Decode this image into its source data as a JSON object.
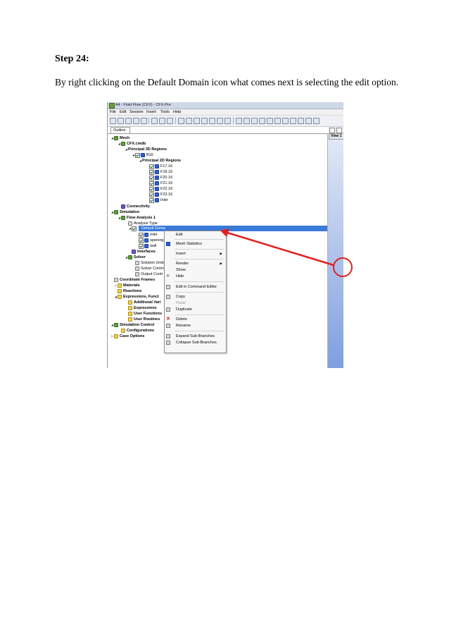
{
  "document": {
    "heading": "Step 24:",
    "instruction": "By right clicking on the Default Domain icon what comes next is selecting the edit option."
  },
  "screenshot": {
    "window_title": "A4 : Fluid Flow (CFX) - CFX-Pre",
    "menu": [
      "File",
      "Edit",
      "Session",
      "Insert",
      "Tools",
      "Help"
    ],
    "outline_tab": "Outline",
    "view_tab": "View 1",
    "tree": {
      "mesh": "Mesh",
      "mesh_file": "CFX.cmdb",
      "principal_3d": "Principal 3D Regions",
      "b16": "B16",
      "principal_2d": "Principal 2D Regions",
      "f17": "F17.16",
      "f18": "F18.16",
      "f20": "F20.16",
      "f21": "F21.16",
      "f22": "F22.16",
      "f23": "F23.16",
      "inlet": "Inlet",
      "connectivity": "Connectivity",
      "simulation": "Simulation",
      "flow_analysis": "Flow Analysis 1",
      "analysis_type": "Analysis Type",
      "default_domain": "Default Doma",
      "dd_inlet": "Inlet",
      "dd_opening": "opening",
      "dd_wall": "wall",
      "interfaces": "Interfaces",
      "solver": "Solver",
      "solution_units": "Solution Units",
      "solver_control": "Solver Contro",
      "output_control": "Output Contr",
      "coordinate_frames": "Coordinate Frames",
      "materials": "Materials",
      "reactions": "Reactions",
      "expressions_functions": "Expressions, Funct",
      "additional_variables": "Additional Vari",
      "expressions": "Expressions",
      "user_functions": "User Functions",
      "user_routines": "User Routines",
      "simulation_control": "Simulation Control",
      "configurations": "Configurations",
      "case_options": "Case Options"
    },
    "context_menu": {
      "edit": "Edit",
      "mesh_statistics": "Mesh Statistics",
      "insert": "Insert",
      "render": "Render",
      "show": "Show",
      "hide": "Hide",
      "edit_in_command_editor": "Edit in Command Editor",
      "copy": "Copy",
      "paste": "Paste",
      "duplicate": "Duplicate",
      "delete": "Delete",
      "rename": "Rename",
      "expand_sub_branches": "Expand Sub-Branches",
      "collapse_sub_branches": "Collapse Sub-Branches"
    },
    "colors": {
      "selection": "#3a7ad9",
      "annotation": "#e02020",
      "tree_icon": "#5f9e3a"
    }
  }
}
